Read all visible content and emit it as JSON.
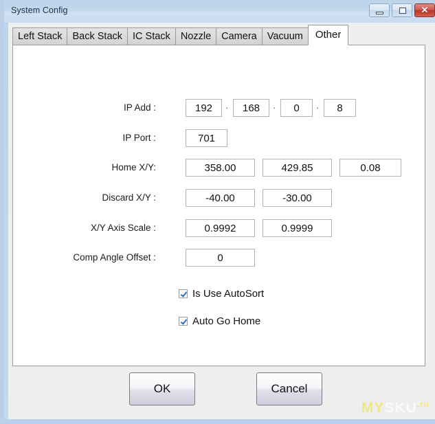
{
  "window": {
    "title": "System Config",
    "controls": [
      {
        "name": "minimize-button",
        "glyph": "minimize-icon",
        "label": ""
      },
      {
        "name": "maximize-button",
        "glyph": "maximize-icon",
        "label": ""
      },
      {
        "name": "close-button",
        "glyph": "close-icon",
        "label": "✕"
      }
    ],
    "colors": {
      "titlebar": "#c2d8ed",
      "frame": "#b9d0e8",
      "client": "#eeeeee",
      "panel": "#ffffff",
      "close_red": "#bb3526",
      "check_blue": "#2f6fc4"
    }
  },
  "tabs": [
    {
      "label": "Left Stack",
      "active": false
    },
    {
      "label": "Back Stack",
      "active": false
    },
    {
      "label": "IC Stack",
      "active": false
    },
    {
      "label": "Nozzle",
      "active": false
    },
    {
      "label": "Camera",
      "active": false
    },
    {
      "label": "Vacuum",
      "active": false
    },
    {
      "label": "Other",
      "active": true
    }
  ],
  "form": {
    "ip_add": {
      "label": "IP Add :",
      "separator": "·",
      "octets": [
        "192",
        "168",
        "0",
        "8"
      ]
    },
    "ip_port": {
      "label": "IP Port :",
      "value": "701"
    },
    "home_xy": {
      "label": "Home X/Y:",
      "values": [
        "358.00",
        "429.85",
        "0.08"
      ]
    },
    "discard_xy": {
      "label": "Discard X/Y :",
      "values": [
        "-40.00",
        "-30.00"
      ]
    },
    "axis_scale": {
      "label": "X/Y Axis Scale :",
      "values": [
        "0.9992",
        "0.9999"
      ]
    },
    "comp_angle_offset": {
      "label": "Comp Angle Offset :",
      "value": "0"
    }
  },
  "checkboxes": [
    {
      "label": "Is Use AutoSort",
      "checked": true
    },
    {
      "label": "Auto Go Home",
      "checked": true
    }
  ],
  "buttons": {
    "ok": "OK",
    "cancel": "Cancel"
  },
  "watermark": {
    "part1": "MY",
    "part2": "SKU",
    "part3": ".ru"
  }
}
